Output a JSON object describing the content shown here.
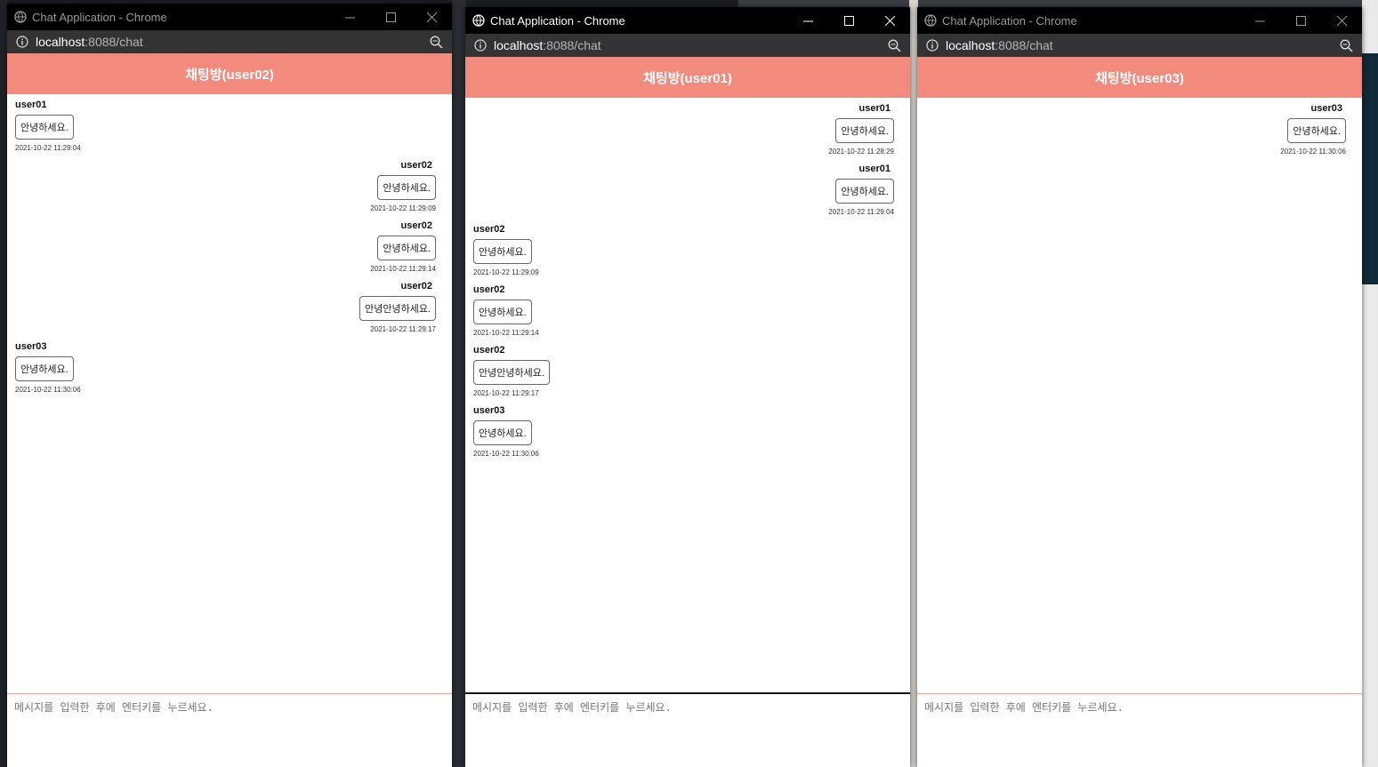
{
  "windows": [
    {
      "title": "Chat Application - Chrome",
      "active": false,
      "url_host": "localhost",
      "url_path": ":8088/chat",
      "room_title": "채팅방(user02)",
      "input_placeholder": "메시지를 입력한 후에 엔터키를 누르세요.",
      "messages": [
        {
          "user": "user01",
          "text": "안녕하세요.",
          "time": "2021-10-22 11:29:04",
          "mine": false
        },
        {
          "user": "user02",
          "text": "안녕하세요.",
          "time": "2021-10-22 11:29:09",
          "mine": true
        },
        {
          "user": "user02",
          "text": "안녕하세요.",
          "time": "2021-10-22 11:29:14",
          "mine": true
        },
        {
          "user": "user02",
          "text": "안녕안녕하세요.",
          "time": "2021-10-22 11:29:17",
          "mine": true
        },
        {
          "user": "user03",
          "text": "안녕하세요.",
          "time": "2021-10-22 11:30:06",
          "mine": false
        }
      ]
    },
    {
      "title": "Chat Application - Chrome",
      "active": true,
      "url_host": "localhost",
      "url_path": ":8088/chat",
      "room_title": "채팅방(user01)",
      "input_placeholder": "메시지를 입력한 후에 엔터키를 누르세요.",
      "messages": [
        {
          "user": "user01",
          "text": "안녕하세요.",
          "time": "2021-10-22 11:28:29",
          "mine": true
        },
        {
          "user": "user01",
          "text": "안녕하세요.",
          "time": "2021-10-22 11:29:04",
          "mine": true
        },
        {
          "user": "user02",
          "text": "안녕하세요.",
          "time": "2021-10-22 11:29:09",
          "mine": false
        },
        {
          "user": "user02",
          "text": "안녕하세요.",
          "time": "2021-10-22 11:29:14",
          "mine": false
        },
        {
          "user": "user02",
          "text": "안녕안녕하세요.",
          "time": "2021-10-22 11:29:17",
          "mine": false
        },
        {
          "user": "user03",
          "text": "안녕하세요.",
          "time": "2021-10-22 11:30:06",
          "mine": false
        }
      ]
    },
    {
      "title": "Chat Application - Chrome",
      "active": false,
      "url_host": "localhost",
      "url_path": ":8088/chat",
      "room_title": "채팅방(user03)",
      "input_placeholder": "메시지를 입력한 후에 엔터키를 누르세요.",
      "messages": [
        {
          "user": "user03",
          "text": "안녕하세요.",
          "time": "2021-10-22 11:30:06",
          "mine": true
        }
      ]
    }
  ],
  "icons": {
    "globe": "globe-icon",
    "info": "info-icon",
    "zoom": "zoom-icon",
    "minimize": "minimize-icon",
    "maximize": "maximize-icon",
    "close": "close-icon"
  },
  "colors": {
    "header": "#f28b7e",
    "titlebar": "#000000",
    "addressbar": "#333333"
  }
}
